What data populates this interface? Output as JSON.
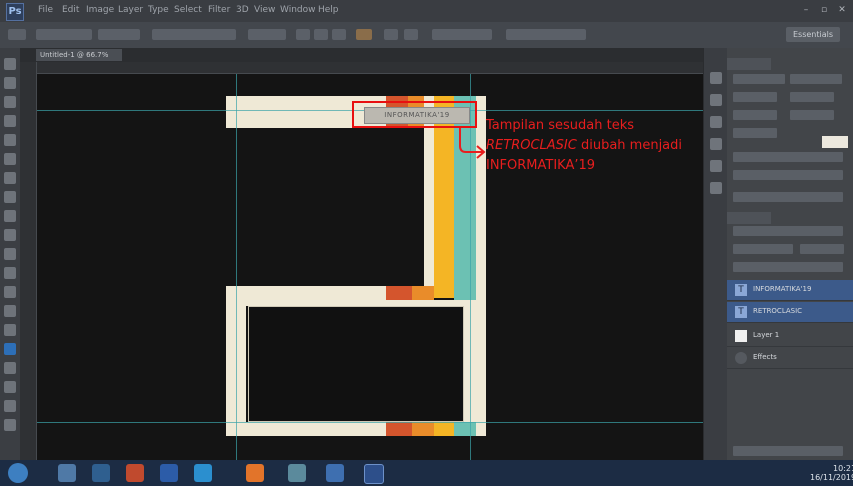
{
  "app": {
    "logo": "Ps",
    "menu_items": [
      "File",
      "Edit",
      "Image",
      "Layer",
      "Type",
      "Select",
      "Filter",
      "3D",
      "View",
      "Window",
      "Help"
    ],
    "workspace_button": "Essentials",
    "document_tab": "Untitled-1 @ 66.7%"
  },
  "canvas": {
    "text_layer_value": "INFORMATIKA'19"
  },
  "annotation": {
    "line1": "Tampilan sesudah teks",
    "line2_italic": "RETROCLASIC",
    "line2_rest": " diubah menjadi",
    "line3": "INFORMATIKA’19"
  },
  "colors": {
    "cream": "#efe9d6",
    "red": "#d4552d",
    "orange": "#e98c2a",
    "yellow": "#f4b525",
    "teal": "#6cc1b3",
    "annotation": "#e81e1e",
    "selected_layer": "#3c5a8a"
  },
  "layers": [
    {
      "name": "INFORMATIKA'19",
      "kind": "text",
      "selected": true
    },
    {
      "name": "RETROCLASIC",
      "kind": "text",
      "selected": true
    },
    {
      "name": "Layer 1",
      "kind": "pixel",
      "selected": false
    },
    {
      "name": "Effects",
      "kind": "effect",
      "selected": false
    }
  ],
  "taskbar": {
    "time": "10:21",
    "date": "16/11/2019"
  }
}
